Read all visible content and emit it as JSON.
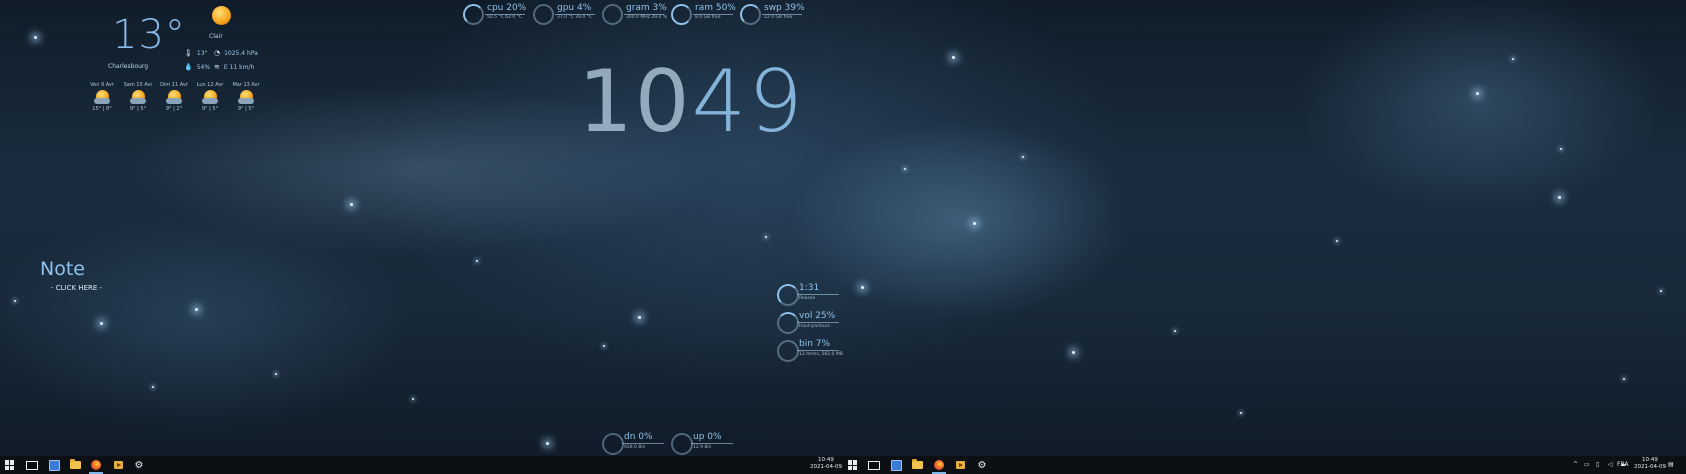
{
  "weather": {
    "temperature": "13°",
    "condition": "Clair",
    "city": "Charlesbourg",
    "feels_like": "13°",
    "pressure": "1025.4 hPa",
    "humidity": "54%",
    "wind": "E 11 km/h",
    "forecast": [
      {
        "day": "Ven 9 Avr",
        "temps": "15° | 8°"
      },
      {
        "day": "Sam 10 Avr",
        "temps": "9° | 5°"
      },
      {
        "day": "Dim 11 Avr",
        "temps": "9° | 2°"
      },
      {
        "day": "Lun 12 Avr",
        "temps": "9° | 5°"
      },
      {
        "day": "Mar 13 Avr",
        "temps": "9° | 5°"
      }
    ]
  },
  "system": [
    {
      "label": "cpu 20%",
      "detail": "50.5 °C  62.0 °C",
      "percent": 20
    },
    {
      "label": "gpu 4%",
      "detail": "37.0 °C  39.0 °C",
      "percent": 4
    },
    {
      "label": "gram 3%",
      "detail": "300.0 MHz  29.0 %",
      "percent": 3
    },
    {
      "label": "ram 50%",
      "detail": "8.0 GB free",
      "percent": 50
    },
    {
      "label": "swp 39%",
      "detail": "22.0 GB free",
      "percent": 39
    }
  ],
  "clock": {
    "hours": "10",
    "minutes": "49"
  },
  "media": [
    {
      "label": "1:31",
      "detail": "Reason",
      "percent": 40
    },
    {
      "label": "vol 25%",
      "detail": "Haut-parleurs",
      "percent": 25
    },
    {
      "label": "bin 7%",
      "detail": "12 items, 582.0 MB",
      "percent": 7
    }
  ],
  "network": [
    {
      "label": "dn 0%",
      "detail": "928.0 B/s",
      "percent": 0
    },
    {
      "label": "up 0%",
      "detail": "12.9 B/s",
      "percent": 0
    }
  ],
  "note": {
    "title": "Note",
    "action": "- CLICK HERE -"
  },
  "taskbar": {
    "center_time": "10:49",
    "center_date": "2021-04-09",
    "right_time": "10:49",
    "right_date": "2021-04-09",
    "language": "FRA"
  },
  "icons": {
    "start": "windows-logo-icon",
    "taskview": "task-view-icon",
    "explorer": "file-explorer-icon",
    "firefox": "firefox-icon",
    "media": "media-player-icon",
    "settings": "gear-icon",
    "computer": "computer-icon"
  }
}
